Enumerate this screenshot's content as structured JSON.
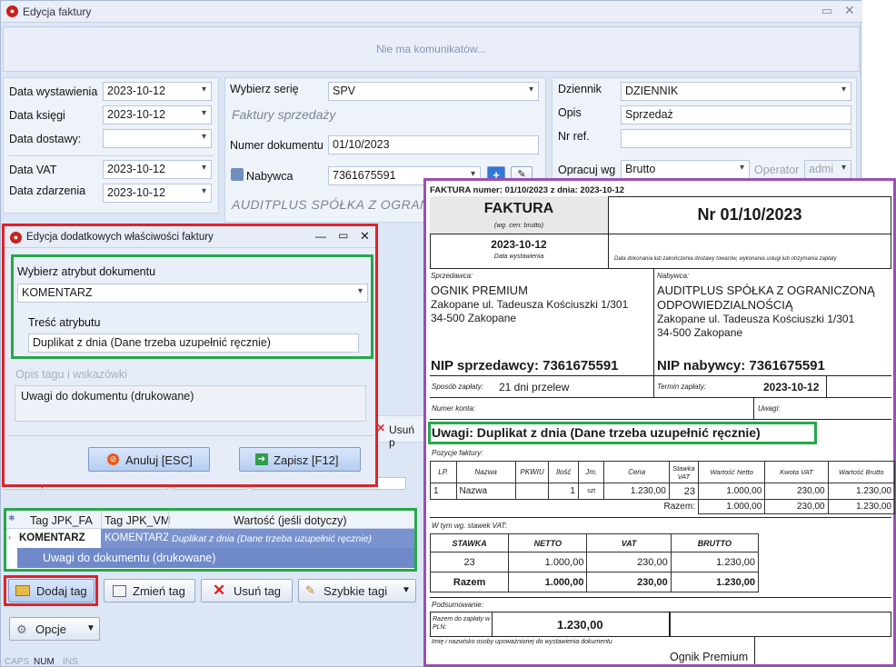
{
  "window": {
    "title": "Edycja faktury"
  },
  "messages": "Nie ma komunikatów...",
  "left_panel": {
    "data_wystawienia": {
      "label": "Data wystawienia",
      "value": "2023-10-12"
    },
    "data_ksiegi": {
      "label": "Data księgi",
      "value": "2023-10-12"
    },
    "data_dostawy": {
      "label": "Data dostawy:",
      "value": ""
    },
    "data_vat": {
      "label": "Data VAT",
      "value": "2023-10-12"
    },
    "data_zdarzenia": {
      "label": "Data zdarzenia",
      "value": "2023-10-12"
    }
  },
  "middle_panel": {
    "seria_label": "Wybierz serię",
    "seria_value": "SPV",
    "seria_desc": "Faktury sprzedaży",
    "numer_label": "Numer dokumentu",
    "numer_value": "01/10/2023",
    "nabywca_label": "Nabywca",
    "nabywca_value": "7361675591",
    "nabywca_name": "AUDITPLUS SPÓŁKA Z OGRANICZ"
  },
  "right_panel": {
    "dziennik_label": "Dziennik",
    "dziennik_value": "DZIENNIK",
    "opis_label": "Opis",
    "opis_value": "Sprzedaż",
    "nrref_label": "Nr ref.",
    "nrref_value": "",
    "opracuj_label": "Opracuj wg",
    "opracuj_value": "Brutto",
    "operator_label": "Operator",
    "operator_value": "admi"
  },
  "dialog": {
    "title": "Edycja dodatkowych właściwości faktury",
    "attr_label": "Wybierz atrybut dokumentu",
    "attr_value": "KOMENTARZ",
    "tresc_label": "Treść atrybutu",
    "tresc_value": "Duplikat z dnia (Dane trzeba uzupełnić ręcznie)",
    "opis_label": "Opis tagu i wskazówki",
    "opis_value": "Uwagi do dokumentu (drukowane)",
    "cancel": "Anuluj [ESC]",
    "save": "Zapisz [F12]"
  },
  "behind": {
    "platnosc": "21 dni przelew",
    "usun_partial": "Usuń p"
  },
  "tags_table": {
    "headers": [
      "Tag JPK_FA",
      "Tag JPK_VM",
      "Wartość (jeśli dotyczy)"
    ],
    "row": {
      "tag_fa": "KOMENTARZ",
      "tag_vm": "KOMENTARZ",
      "value": "Duplikat z dnia (Dane trzeba uzupełnić ręcznie)"
    },
    "row_desc": "Uwagi do dokumentu (drukowane)"
  },
  "toolbar": {
    "dodaj": "Dodaj tag",
    "zmien": "Zmień tag",
    "usun": "Usuń tag",
    "szybkie": "Szybkie tagi",
    "opcje": "Opcje"
  },
  "statusbar": {
    "caps": "CAPS",
    "num": "NUM",
    "ins": "INS"
  },
  "invoice": {
    "header_line": "FAKTURA numer: 01/10/2023 z dnia: 2023-10-12",
    "faktura": "FAKTURA",
    "wg_cen": "(wg. cen: brutto)",
    "nr": "Nr 01/10/2023",
    "date": "2023-10-12",
    "data_wyst_lbl": "Data wystawienia",
    "data_dokon_lbl": "Data dokonania lub zakończenia dostawy towarów, wykonania usługi lub otrzymania zapłaty",
    "sprzedawca_lbl": "Sprzedawca:",
    "seller_name": "OGNIK PREMIUM",
    "seller_addr1": "Zakopane ul. Tadeusza Kościuszki 1/301",
    "seller_addr2": "34-500 Zakopane",
    "nabywca_lbl": "Nabywca:",
    "buyer_name1": "AUDITPLUS SPÓŁKA Z OGRANICZONĄ",
    "buyer_name2": "ODPOWIEDZIALNOŚCIĄ",
    "buyer_addr1": "Zakopane ul. Tadeusza Kościuszki 1/301",
    "buyer_addr2": "34-500 Zakopane",
    "nip_seller": "NIP sprzedawcy: 7361675591",
    "nip_buyer": "NIP nabywcy: 7361675591",
    "sposob_lbl": "Sposób zapłaty:",
    "sposob_val": "21 dni przelew",
    "termin_lbl": "Termin zapłaty:",
    "termin_val": "2023-10-12",
    "konto_lbl": "Numer konta:",
    "uwagi_lbl": "Uwagi:",
    "uwagi_big": "Uwagi:  Duplikat z dnia (Dane trzeba uzupełnić ręcznie)",
    "pozycje_lbl": "Pozycje faktury:",
    "items_headers": [
      "LP.",
      "Nazwa",
      "PKWIU",
      "Ilość",
      "Jm.",
      "Cena",
      "Stawka VAT",
      "Wartość Netto",
      "Kwota VAT",
      "Wartość Brutto"
    ],
    "item": [
      "1",
      "Nazwa",
      "",
      "1",
      "szt",
      "1.230,00",
      "23",
      "1.000,00",
      "230,00",
      "1.230,00"
    ],
    "razem_lbl": "Razem:",
    "razem_vals": [
      "1.000,00",
      "230,00",
      "1.230,00"
    ],
    "wtym_lbl": "W tym wg. stawek VAT:",
    "vat_headers": [
      "STAWKA",
      "NETTO",
      "VAT",
      "BRUTTO"
    ],
    "vat_row": [
      "23",
      "1.000,00",
      "230,00",
      "1.230,00"
    ],
    "vat_total": [
      "Razem",
      "1.000,00",
      "230,00",
      "1.230,00"
    ],
    "podsum_lbl": "Podsumowanie:",
    "razem_zaplaty_lbl": "Razem do zapłaty w PLN:",
    "razem_zaplaty_val": "1.230,00",
    "imie_lbl": "Imię i nazwisko osoby upoważnionej do wystawienia dokumentu",
    "signer": "Ognik Premium"
  }
}
